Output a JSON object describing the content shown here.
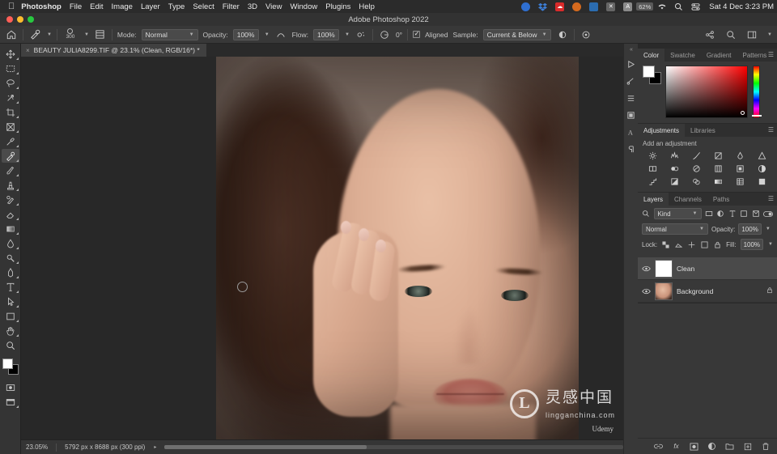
{
  "macbar": {
    "apple": "apple-logo",
    "app_name": "Photoshop",
    "menus": [
      "File",
      "Edit",
      "Image",
      "Layer",
      "Type",
      "Select",
      "Filter",
      "3D",
      "View",
      "Window",
      "Plugins",
      "Help"
    ],
    "status_icons": [
      "record-icon",
      "dropbox-icon",
      "creative-cloud-icon",
      "circle-icon",
      "adobe-icon",
      "x-icon",
      "user-icon",
      "battery-icon",
      "wifi-icon",
      "search-icon",
      "control-center-icon"
    ],
    "battery": "62%",
    "clock": "Sat 4 Dec  3:23 PM"
  },
  "window": {
    "title": "Adobe Photoshop 2022"
  },
  "options_bar": {
    "home_icon": "home-icon",
    "tool_icon": "healing-brush-icon",
    "brush_size": "300",
    "panel_toggle_icon": "brush-panel-icon",
    "mode_label": "Mode:",
    "mode_value": "Normal",
    "opacity_label": "Opacity:",
    "opacity_value": "100%",
    "flow_label": "Flow:",
    "flow_value": "100%",
    "airbrush_icon": "airbrush-icon",
    "pressure_icon": "pressure-icon",
    "angle_value": "0°",
    "aligned_label": "Aligned",
    "aligned_checked": true,
    "sample_label": "Sample:",
    "sample_value": "Current & Below",
    "sample_mask_icon": "sample-mask-icon",
    "pressure_size_icon": "pressure-size-icon",
    "right_icons": [
      "share-icon",
      "search-icon",
      "workspace-icon",
      "chevron-down-icon"
    ]
  },
  "tab": {
    "close": "×",
    "title": "BEAUTY JULIA8299.TIF @ 23.1% (Clean, RGB/16*) *"
  },
  "toolbar": {
    "tools": [
      {
        "name": "move-tool",
        "glyph": "move"
      },
      {
        "name": "marquee-tool",
        "glyph": "marquee"
      },
      {
        "name": "lasso-tool",
        "glyph": "lasso"
      },
      {
        "name": "object-selection-tool",
        "glyph": "wand"
      },
      {
        "name": "crop-tool",
        "glyph": "crop"
      },
      {
        "name": "frame-tool",
        "glyph": "frame"
      },
      {
        "name": "eyedropper-tool",
        "glyph": "eyedropper"
      },
      {
        "name": "healing-brush-tool",
        "glyph": "healing",
        "active": true
      },
      {
        "name": "brush-tool",
        "glyph": "brush"
      },
      {
        "name": "clone-stamp-tool",
        "glyph": "stamp"
      },
      {
        "name": "history-brush-tool",
        "glyph": "historybrush"
      },
      {
        "name": "eraser-tool",
        "glyph": "eraser"
      },
      {
        "name": "gradient-tool",
        "glyph": "gradient"
      },
      {
        "name": "blur-tool",
        "glyph": "blur"
      },
      {
        "name": "dodge-tool",
        "glyph": "dodge"
      },
      {
        "name": "pen-tool",
        "glyph": "pen"
      },
      {
        "name": "type-tool",
        "glyph": "type"
      },
      {
        "name": "path-selection-tool",
        "glyph": "pathselect"
      },
      {
        "name": "shape-tool",
        "glyph": "shape"
      },
      {
        "name": "hand-tool",
        "glyph": "hand"
      },
      {
        "name": "zoom-tool",
        "glyph": "zoom"
      }
    ],
    "foreground_color": "#ffffff",
    "background_color": "#000000",
    "extra": [
      {
        "name": "quick-mask-tool",
        "glyph": "quickmask"
      },
      {
        "name": "screen-mode-tool",
        "glyph": "screenmode"
      }
    ]
  },
  "status_bar": {
    "zoom": "23.05%",
    "doc_info": "5792 px x 8688 px (300 ppi)"
  },
  "dock_rail": {
    "items": [
      "collapse-icon",
      "play-icon",
      "history-icon",
      "properties-icon",
      "swatch-icon",
      "character-icon",
      "paragraph-icon"
    ]
  },
  "color_panel": {
    "tabs": [
      "Color",
      "Swatche",
      "Gradient",
      "Patterns"
    ],
    "active_tab": "Color",
    "menu_icon": "panel-menu-icon",
    "foreground": "#ffffff",
    "background": "#000000"
  },
  "adjustments_panel": {
    "tabs": [
      "Adjustments",
      "Libraries"
    ],
    "active_tab": "Adjustments",
    "menu_icon": "panel-menu-icon",
    "label": "Add an adjustment",
    "icons": [
      "brightness-contrast-icon",
      "levels-icon",
      "curves-icon",
      "exposure-icon",
      "vibrance-icon",
      "hue-saturation-icon",
      "color-balance-icon",
      "black-white-icon",
      "photo-filter-icon",
      "channel-mixer-icon",
      "color-lookup-icon",
      "invert-icon",
      "posterize-icon",
      "threshold-icon",
      "selective-color-icon",
      "gradient-map-icon",
      "pattern-icon",
      "solid-color-icon"
    ]
  },
  "layers_panel": {
    "tabs": [
      "Layers",
      "Channels",
      "Paths"
    ],
    "active_tab": "Layers",
    "menu_icon": "panel-menu-icon",
    "filter": {
      "search_icon": "search-icon",
      "kind_label": "Kind",
      "filter_icons": [
        "pixel-filter-icon",
        "adjustment-filter-icon",
        "type-filter-icon",
        "shape-filter-icon",
        "smart-object-filter-icon"
      ],
      "toggle_icon": "filter-toggle-icon"
    },
    "blend_mode": "Normal",
    "opacity_label": "Opacity:",
    "opacity_value": "100%",
    "lock_label": "Lock:",
    "lock_icons": [
      "lock-transparent-icon",
      "lock-image-icon",
      "lock-position-icon",
      "lock-artboard-icon",
      "lock-all-icon"
    ],
    "fill_label": "Fill:",
    "fill_value": "100%",
    "layers": [
      {
        "name": "Clean",
        "visible": true,
        "selected": true,
        "locked": false,
        "thumb": "white"
      },
      {
        "name": "Background",
        "visible": true,
        "selected": false,
        "locked": true,
        "thumb": "portrait"
      }
    ],
    "footer_icons": [
      "link-icon",
      "fx-icon",
      "mask-icon",
      "adjustment-icon",
      "group-icon",
      "new-layer-icon",
      "delete-icon"
    ]
  },
  "watermark": {
    "logo": "L",
    "text_cn": "灵感中国",
    "text_en": "lingganchina.com",
    "udemy": "Udemy"
  }
}
